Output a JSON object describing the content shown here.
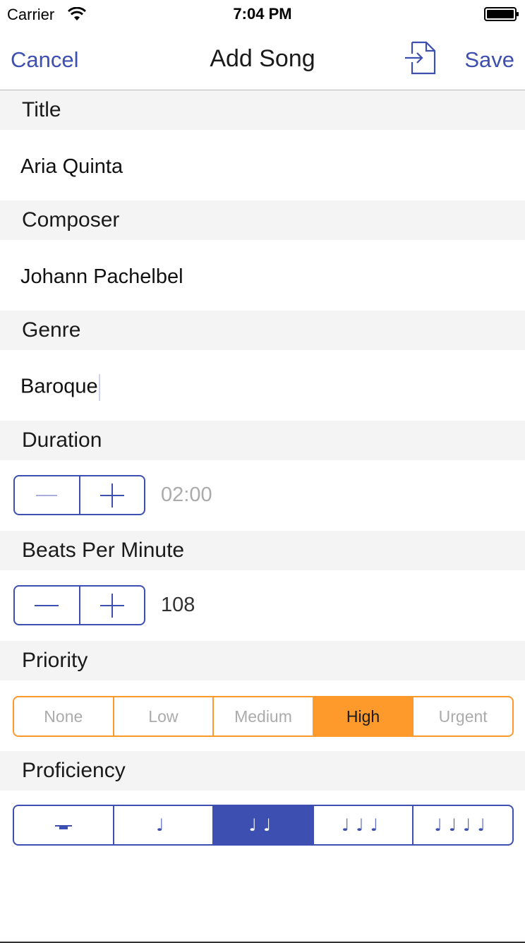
{
  "status_bar": {
    "carrier": "Carrier",
    "time": "7:04 PM",
    "wifi_icon": "wifi-icon",
    "battery_icon": "battery-icon"
  },
  "nav": {
    "cancel_label": "Cancel",
    "title": "Add Song",
    "import_icon": "document-import-icon",
    "save_label": "Save"
  },
  "sections": {
    "title": {
      "label": "Title",
      "value": "Aria Quinta"
    },
    "composer": {
      "label": "Composer",
      "value": "Johann Pachelbel"
    },
    "genre": {
      "label": "Genre",
      "value": "Baroque"
    },
    "duration": {
      "label": "Duration",
      "value": "02:00",
      "decrement_enabled": false
    },
    "bpm": {
      "label": "Beats Per Minute",
      "value": "108",
      "decrement_enabled": true
    },
    "priority": {
      "label": "Priority",
      "options": [
        "None",
        "Low",
        "Medium",
        "High",
        "Urgent"
      ],
      "selected": "High"
    },
    "proficiency": {
      "label": "Proficiency",
      "options": [
        "rest",
        "♩",
        "♩♩",
        "♩♩♩",
        "♩♩♩♩"
      ],
      "selected_index": 2
    }
  },
  "colors": {
    "accent_blue": "#3d4fb0",
    "accent_orange": "#fd9a2b",
    "section_background": "#f4f4f4",
    "disabled_text": "#ababab"
  }
}
